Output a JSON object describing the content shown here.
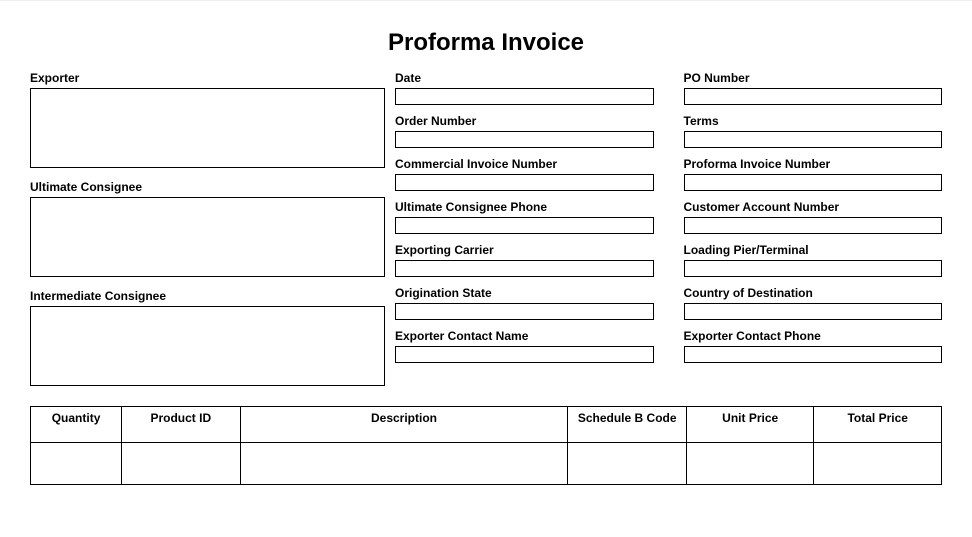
{
  "title": "Proforma Invoice",
  "left_blocks": {
    "exporter": {
      "label": "Exporter",
      "value": ""
    },
    "ultimate_consignee": {
      "label": "Ultimate Consignee",
      "value": ""
    },
    "intermediate_consignee": {
      "label": "Intermediate Consignee",
      "value": ""
    }
  },
  "mid_fields": {
    "date": {
      "label": "Date",
      "value": ""
    },
    "order_number": {
      "label": "Order Number",
      "value": ""
    },
    "commercial_invoice_number": {
      "label": "Commercial Invoice Number",
      "value": ""
    },
    "ultimate_consignee_phone": {
      "label": "Ultimate Consignee Phone",
      "value": ""
    },
    "exporting_carrier": {
      "label": "Exporting Carrier",
      "value": ""
    },
    "origination_state": {
      "label": "Origination State",
      "value": ""
    },
    "exporter_contact_name": {
      "label": "Exporter Contact Name",
      "value": ""
    }
  },
  "right_fields": {
    "po_number": {
      "label": "PO Number",
      "value": ""
    },
    "terms": {
      "label": "Terms",
      "value": ""
    },
    "proforma_invoice_number": {
      "label": "Proforma Invoice Number",
      "value": ""
    },
    "customer_account_number": {
      "label": "Customer Account Number",
      "value": ""
    },
    "loading_pier_terminal": {
      "label": "Loading Pier/Terminal",
      "value": ""
    },
    "country_of_destination": {
      "label": "Country of Destination",
      "value": ""
    },
    "exporter_contact_phone": {
      "label": "Exporter Contact Phone",
      "value": ""
    }
  },
  "items_table": {
    "headers": {
      "quantity": "Quantity",
      "product_id": "Product ID",
      "description": "Description",
      "schedule_b": "Schedule B Code",
      "unit_price": "Unit Price",
      "total_price": "Total Price"
    },
    "rows": [
      {
        "quantity": "",
        "product_id": "",
        "description": "",
        "schedule_b": "",
        "unit_price": "",
        "total_price": ""
      }
    ]
  }
}
